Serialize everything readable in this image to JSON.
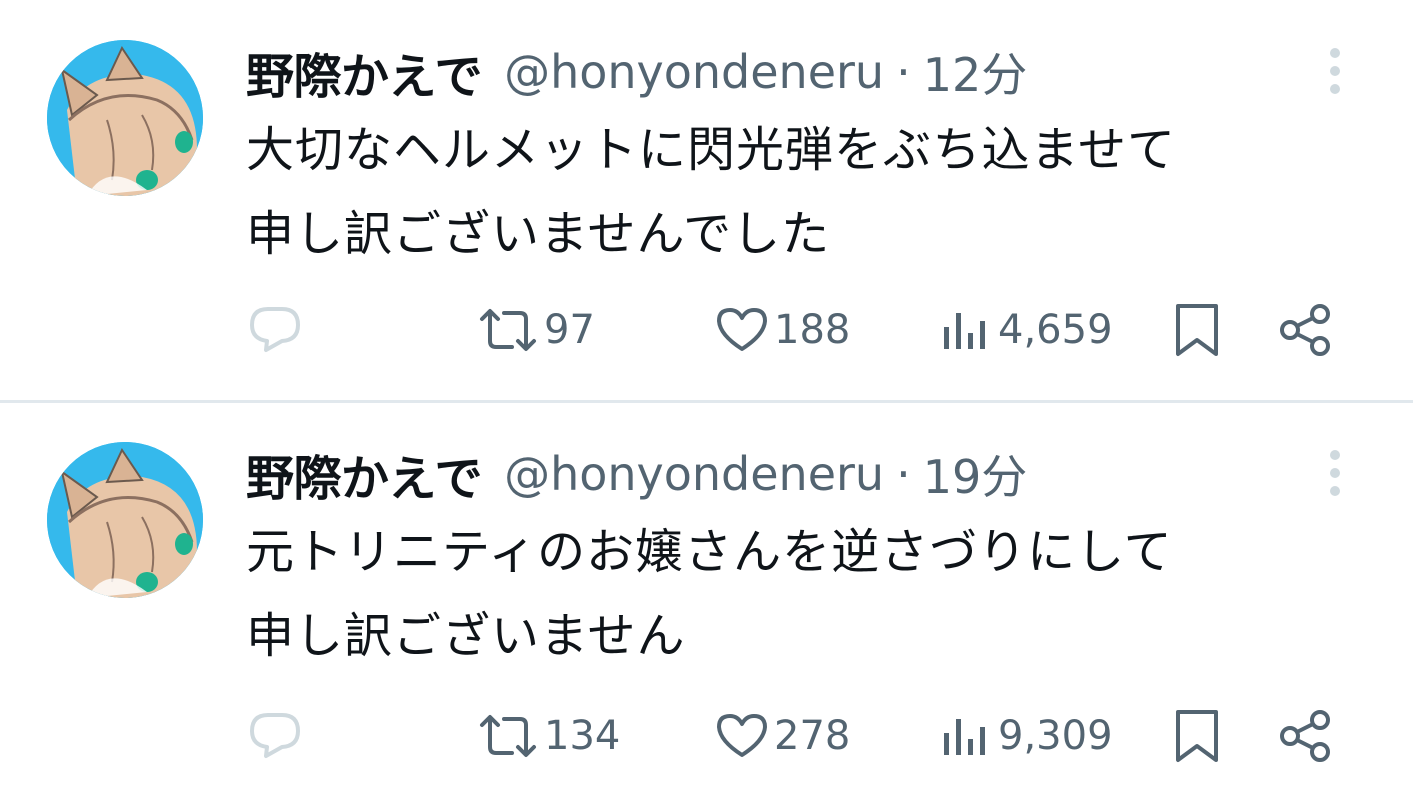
{
  "tweets": [
    {
      "author_name": "野際かえで",
      "handle": "@honyondeneru",
      "separator": "·",
      "time": "12分",
      "text_lines": [
        "大切なヘルメットに閃光弾をぶち込ませて",
        "申し訳ございませんでした"
      ],
      "retweets": "97",
      "likes": "188",
      "views": "4,659"
    },
    {
      "author_name": "野際かえで",
      "handle": "@honyondeneru",
      "separator": "·",
      "time": "19分",
      "text_lines": [
        "元トリニティのお嬢さんを逆さづりにして",
        "申し訳ございません"
      ],
      "retweets": "134",
      "likes": "278",
      "views": "9,309"
    }
  ],
  "icons": {
    "more": "more-vertical-icon",
    "reply": "reply-icon",
    "retweet": "retweet-icon",
    "like": "heart-icon",
    "views": "views-bar-chart-icon",
    "bookmark": "bookmark-icon",
    "share": "share-icon"
  },
  "colors": {
    "text_primary": "#0f1419",
    "text_secondary": "#536471",
    "icon_light": "#cfd9de",
    "divider": "#e1e8ed",
    "avatar_bg": "#35b9ec"
  }
}
